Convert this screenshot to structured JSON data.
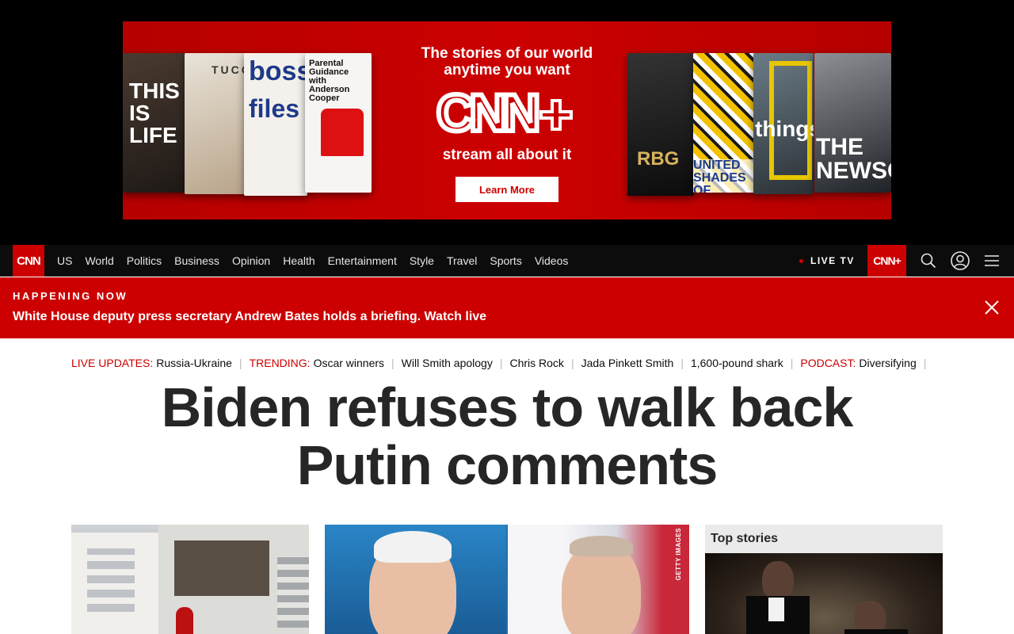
{
  "ad": {
    "tagline": "The stories of our world anytime you want",
    "logo_text": "CNN+",
    "subtitle": "stream all about it",
    "button_label": "Learn More",
    "posters": [
      {
        "title": "THIS IS LIFE"
      },
      {
        "title": "TUCCI"
      },
      {
        "title": "boss",
        "title2": "files"
      },
      {
        "title": "Parental Guidance with Anderson Cooper"
      },
      {
        "title": "RBG"
      },
      {
        "title": "UNITED SHADES OF AMERICA"
      },
      {
        "title": "things"
      },
      {
        "title": "THE NEWSCAST"
      }
    ]
  },
  "nav": {
    "logo": "CNN",
    "links": [
      "US",
      "World",
      "Politics",
      "Business",
      "Opinion",
      "Health",
      "Entertainment",
      "Style",
      "Travel",
      "Sports",
      "Videos"
    ],
    "live_tv": "LIVE TV",
    "cnn_plus": "CNN+"
  },
  "breaking": {
    "label": "HAPPENING NOW",
    "text": "White House deputy press secretary Andrew Bates holds a briefing. Watch live"
  },
  "trending": {
    "live_label": "LIVE UPDATES:",
    "live_item": "Russia-Ukraine",
    "trending_label": "TRENDING:",
    "items": [
      "Oscar winners",
      "Will Smith apology",
      "Chris Rock",
      "Jada Pinkett Smith",
      "1,600-pound shark"
    ],
    "podcast_label": "PODCAST:",
    "podcast_item": "Diversifying"
  },
  "headline": {
    "line1": "Biden refuses to walk back",
    "line2": "Putin comments"
  },
  "cards": {
    "photo_credit": "GETTY IMAGES",
    "top_stories_title": "Top stories"
  },
  "colors": {
    "brand_red": "#cc0000",
    "nav_bg": "#0c0c0c",
    "headline": "#262626"
  }
}
